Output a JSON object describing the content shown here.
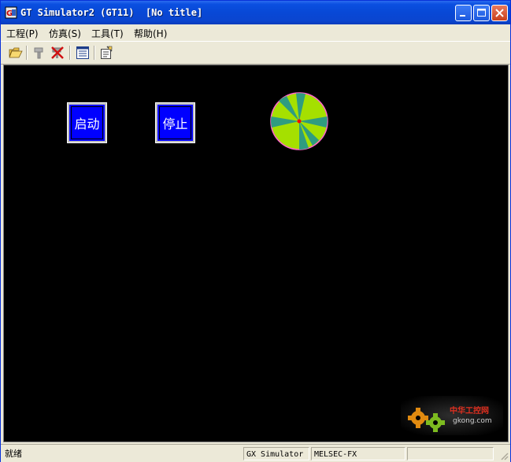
{
  "window": {
    "title": "GT Simulator2 (GT11)  [No title]"
  },
  "menu": {
    "items": [
      {
        "label": "工程(P)"
      },
      {
        "label": "仿真(S)"
      },
      {
        "label": "工具(T)"
      },
      {
        "label": "帮助(H)"
      }
    ]
  },
  "toolbar": {
    "icons": [
      "open-folder-icon",
      "disconnect-icon",
      "stop-icon",
      "list-icon",
      "properties-icon"
    ]
  },
  "screen": {
    "background": "#000000",
    "start_button": {
      "label": "启动"
    },
    "stop_button": {
      "label": "停止"
    },
    "lamp": {
      "color": "#a5e000",
      "accent": "#2f9c80",
      "center": "#ff0000",
      "rim": "#ff66cc"
    }
  },
  "watermark": {
    "text_top": "中华工控网",
    "text_bottom": "gkong.com"
  },
  "statusbar": {
    "status": "就绪",
    "pane1": "GX Simulator",
    "pane2": "MELSEC-FX",
    "pane3": ""
  },
  "colors": {
    "titlebar": "#0848d6",
    "hmi_button": "#0000ff",
    "chrome": "#ece9d8"
  }
}
